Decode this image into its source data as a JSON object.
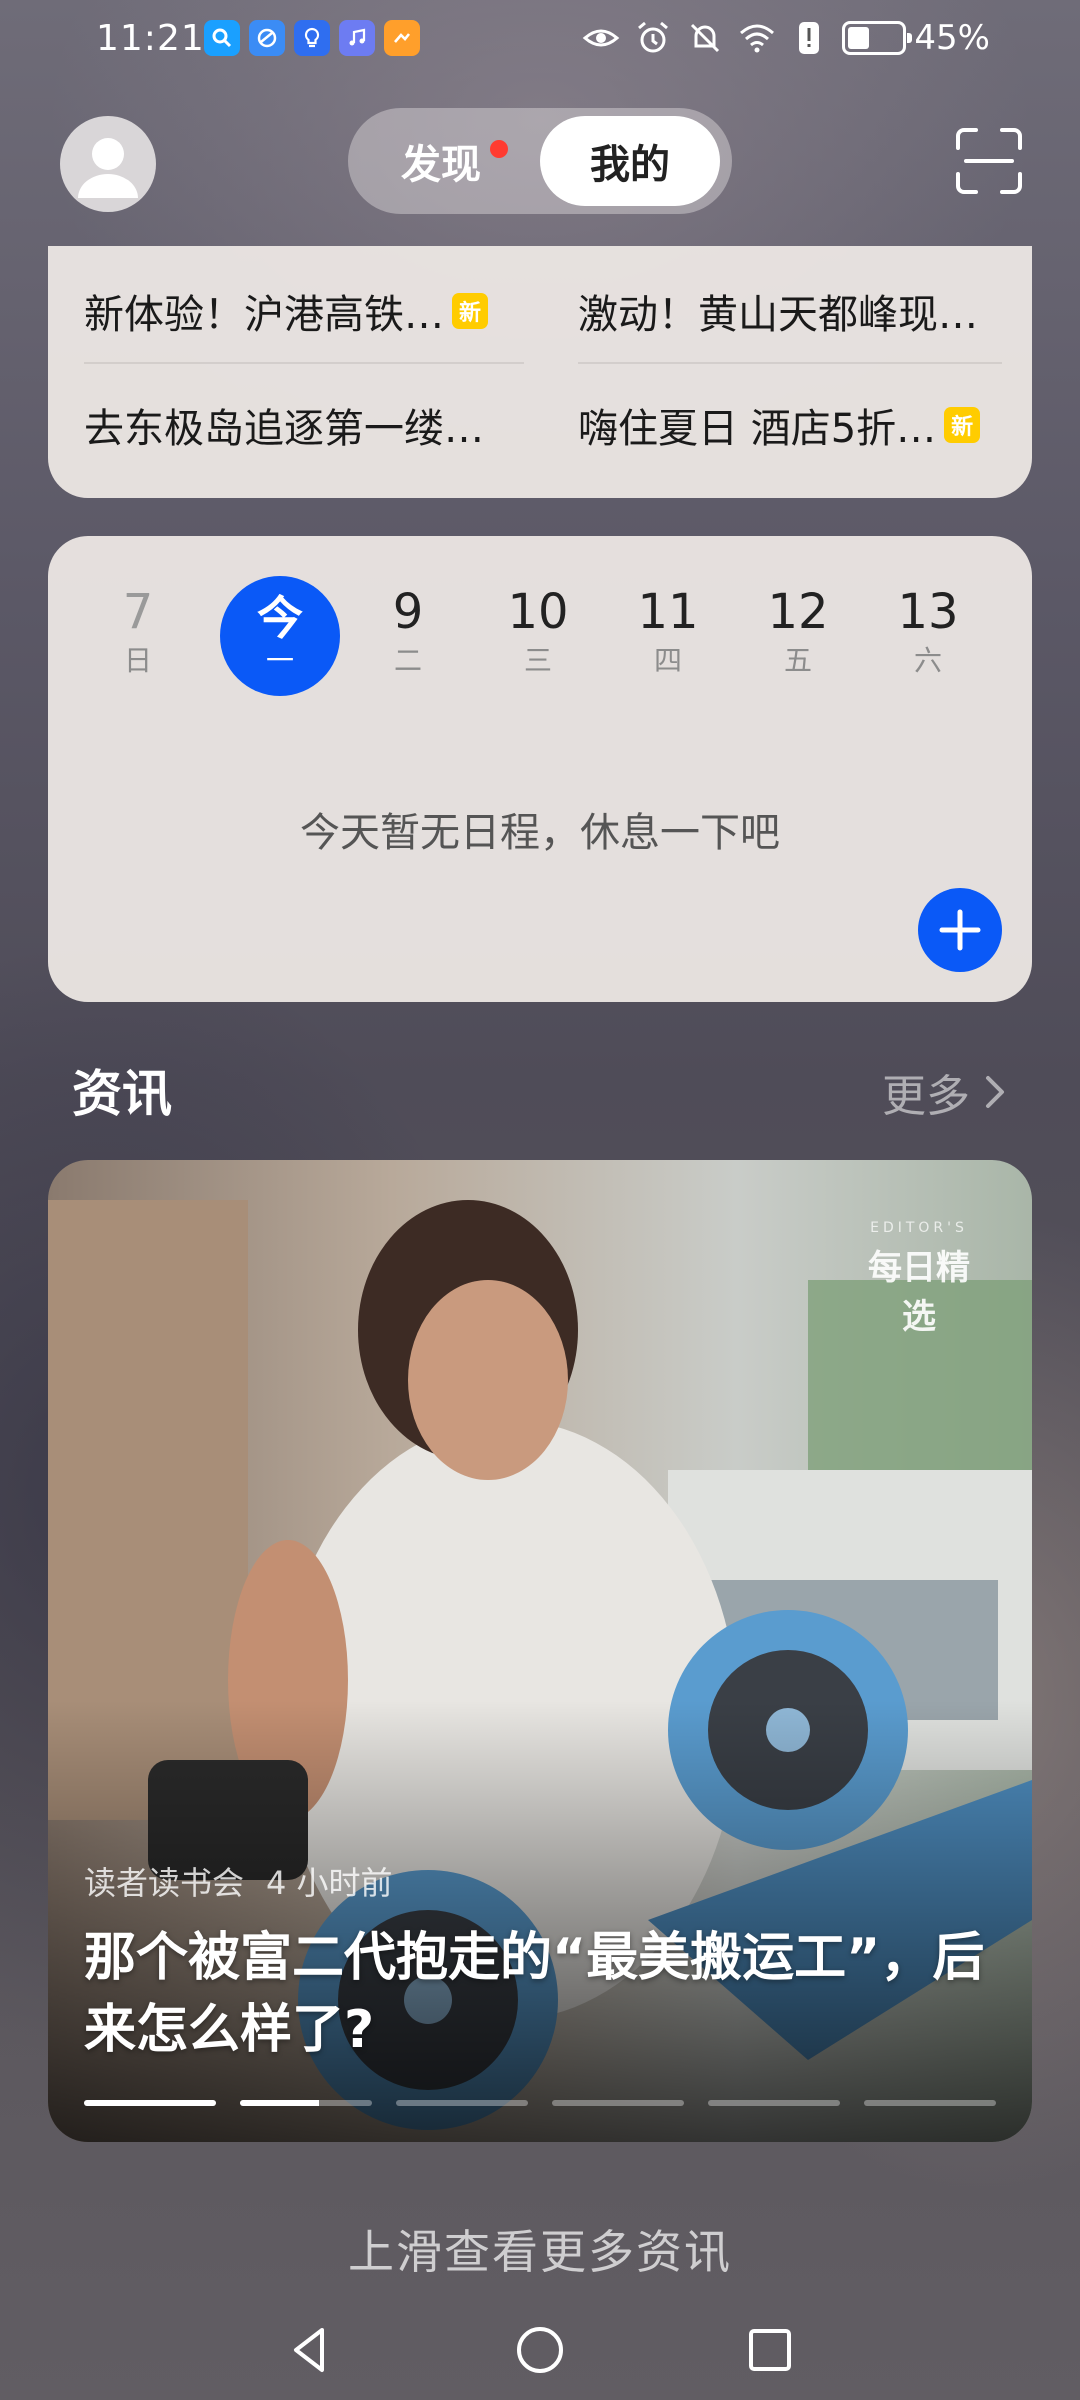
{
  "status_bar": {
    "time": "11:21",
    "battery_percent": "45%",
    "battery_level": 0.45,
    "app_icons": [
      "search-app-icon",
      "browser-app-icon",
      "tips-app-icon",
      "music-app-icon",
      "photo-app-icon"
    ],
    "system_icons": [
      "eye-icon",
      "alarm-icon",
      "mute-bell-icon",
      "wifi-icon",
      "alert-icon",
      "battery-icon"
    ]
  },
  "header": {
    "tabs": [
      {
        "label": "发现",
        "has_dot": true,
        "active": false
      },
      {
        "label": "我的",
        "active": true
      }
    ]
  },
  "hot_topics": [
    {
      "text": "新体验！沪港高铁…",
      "new": true,
      "badge": "新"
    },
    {
      "text": "激动！黄山天都峰现…",
      "new": false
    },
    {
      "text": "去东极岛追逐第一缕…",
      "new": false
    },
    {
      "text": "嗨住夏日 酒店5折…",
      "new": true,
      "badge": "新"
    }
  ],
  "calendar": {
    "days": [
      {
        "num": "7",
        "weekday": "日"
      },
      {
        "num": "今",
        "weekday": "一",
        "today": true
      },
      {
        "num": "9",
        "weekday": "二"
      },
      {
        "num": "10",
        "weekday": "三"
      },
      {
        "num": "11",
        "weekday": "四"
      },
      {
        "num": "12",
        "weekday": "五"
      },
      {
        "num": "13",
        "weekday": "六"
      }
    ],
    "empty_text": "今天暂无日程，休息一下吧"
  },
  "news": {
    "section_title": "资讯",
    "more_label": "更多",
    "card": {
      "badge": "每日精选",
      "badge_ring": "EDITOR'S",
      "source": "读者读书会",
      "time_ago": "4 小时前",
      "headline": "那个被富二代抱走的“最美搬运工”，后来怎么样了?",
      "pager_total": 6,
      "pager_active": 1,
      "pager_progress": 0.6
    }
  },
  "swipe_hint": "上滑查看更多资讯",
  "colors": {
    "accent": "#0a59f7",
    "new_badge": "#ffcc00",
    "red_dot": "#ff3b30"
  }
}
